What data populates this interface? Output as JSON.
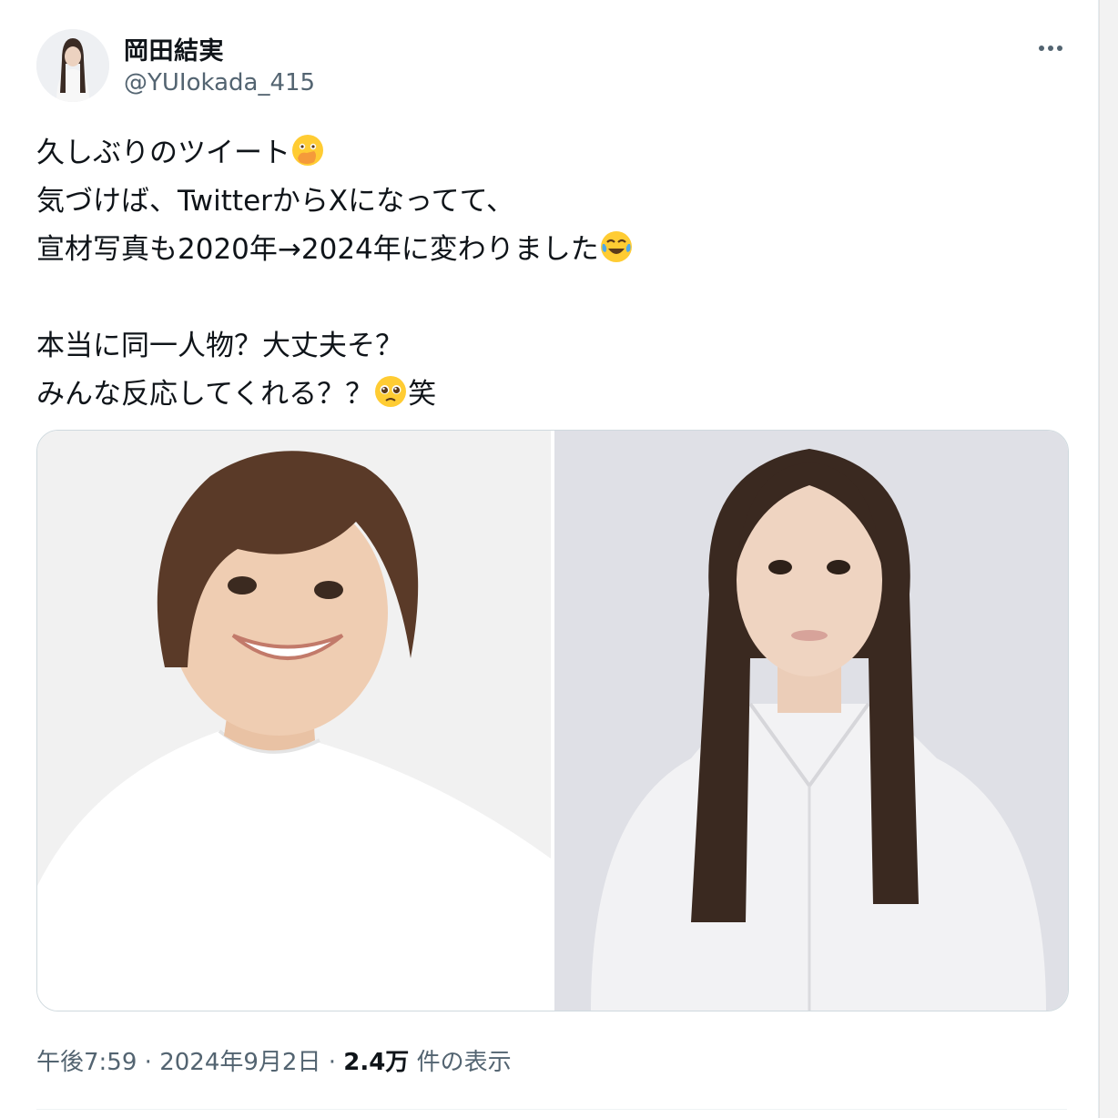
{
  "author": {
    "display_name": "岡田結実",
    "handle": "@YUIokada_415"
  },
  "tweet": {
    "lines": [
      {
        "text": "久しぶりのツイート",
        "emoji": "face-with-open-eyes-and-hand-over-mouth"
      },
      {
        "text": "気づけば、TwitterからXになってて、",
        "emoji": ""
      },
      {
        "text": "宣材写真も2020年→2024年に変わりました",
        "emoji": "face-with-tears-of-joy"
      },
      {
        "text": "",
        "emoji": ""
      },
      {
        "text": "本当に同一人物？大丈夫そ？",
        "emoji": ""
      },
      {
        "text": "みんな反応してくれる？？",
        "emoji": "pleading-face",
        "suffix": "笑"
      }
    ]
  },
  "media": {
    "photos": [
      {
        "name": "photo-2020",
        "background": "#f1f1f1"
      },
      {
        "name": "photo-2024",
        "background": "#dfe0e6"
      }
    ]
  },
  "meta": {
    "time": "午後7:59",
    "separator": "·",
    "date": "2024年9月2日",
    "views_count": "2.4万",
    "views_label": "件の表示"
  },
  "colors": {
    "text": "#0f1419",
    "secondary": "#536471",
    "border": "#cfd9de",
    "emoji_yellow": "#ffcc33"
  }
}
